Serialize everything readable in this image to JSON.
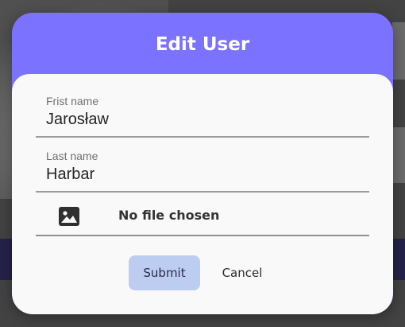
{
  "dialog": {
    "title": "Edit User",
    "accent_color": "#7b73ff",
    "fields": {
      "first_name": {
        "label": "Frist name",
        "value": "Jarosław"
      },
      "last_name": {
        "label": "Last name",
        "value": "Harbar"
      }
    },
    "file": {
      "icon": "image-icon",
      "text": "No file chosen"
    },
    "buttons": {
      "submit": "Submit",
      "cancel": "Cancel"
    }
  }
}
